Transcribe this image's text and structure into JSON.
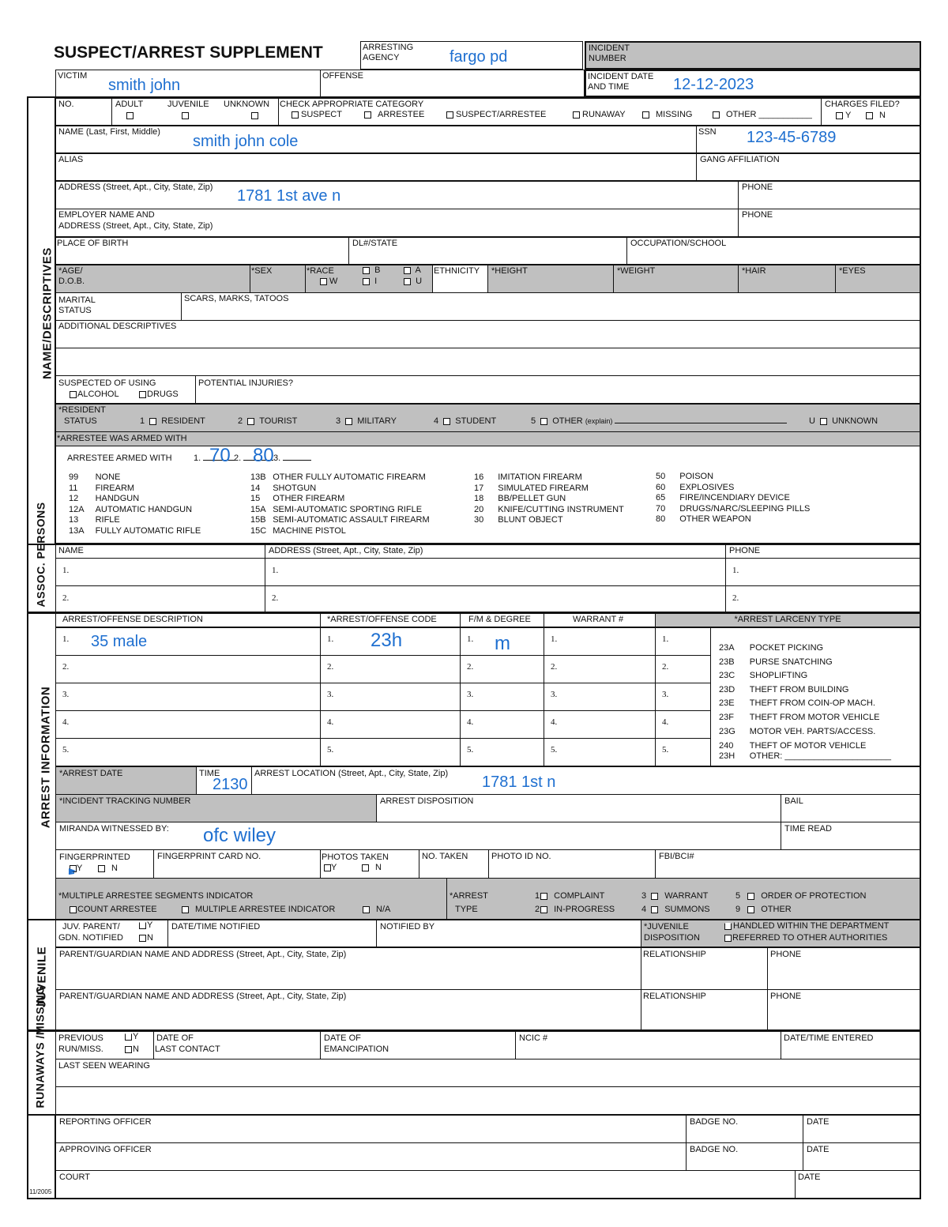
{
  "header": {
    "title": "SUSPECT/ARREST SUPPLEMENT",
    "arresting_agency_label": "ARRESTING AGENCY",
    "arresting_agency_value": "fargo pd",
    "incident_number_label": "INCIDENT NUMBER",
    "incident_number_value": "",
    "victim_label": "VICTIM",
    "victim_value": "smith john",
    "offense_label": "OFFENSE",
    "offense_value": "",
    "incident_date_label": "INCIDENT DATE AND TIME",
    "incident_date_value": "12-12-2023"
  },
  "sections": {
    "name_descriptives": "NAME/DESCRIPTIVES",
    "assoc_persons": "ASSOC. PERSONS",
    "arrest_information": "ARREST INFORMATION",
    "juvenile": "JUVENILE",
    "runaways_missing": "RUNAWAYS /MISSING",
    "form_version": "11/2005"
  },
  "name": {
    "no_label": "NO.",
    "adult_label": "ADULT",
    "juvenile_label": "JUVENILE",
    "unknown_label": "UNKNOWN",
    "category_label": "CHECK APPROPRIATE CATEGORY",
    "categories": [
      "SUSPECT",
      "ARRESTEE",
      "SUSPECT/ARRESTEE",
      "RUNAWAY",
      "MISSING",
      "OTHER ___________"
    ],
    "charges_filed_label": "CHARGES FILED?",
    "yes": "Y",
    "no": "N",
    "full_name_label": "NAME (Last, First, Middle)",
    "full_name_value": "smith john cole",
    "ssn_label": "SSN",
    "ssn_value": "123-45-6789",
    "alias_label": "ALIAS",
    "gang_label": "GANG AFFILIATION",
    "address_label": "ADDRESS (Street, Apt., City, State, Zip)",
    "address_value": "1781 1st ave n",
    "phone_label": "PHONE",
    "employer_label_1": "EMPLOYER NAME AND",
    "employer_label_2": "ADDRESS (Street, Apt., City, State, Zip)",
    "pob_label": "PLACE OF BIRTH",
    "dl_label": "DL#/STATE",
    "occupation_label": "OCCUPATION/SCHOOL",
    "age_label": "*AGE/",
    "dob_label": "D.O.B.",
    "sex_label": "*SEX",
    "race_label": "*RACE",
    "race_options": [
      "W",
      "B",
      "I",
      "A",
      "U"
    ],
    "ethnicity_label": "ETHNICITY",
    "height_label": "*HEIGHT",
    "weight_label": "*WEIGHT",
    "hair_label": "*HAIR",
    "eyes_label": "*EYES",
    "marital_label_1": "MARITAL",
    "marital_label_2": "STATUS",
    "scars_label": "SCARS, MARKS, TATOOS",
    "additional_label": "ADDITIONAL DESCRIPTIVES",
    "suspected_label": "SUSPECTED OF USING",
    "alcohol": "ALCOHOL",
    "drugs": "DRUGS",
    "injuries_label": "POTENTIAL INJURIES?",
    "resident_label_1": "*RESIDENT",
    "resident_label_2": "STATUS",
    "resident_options": [
      {
        "code": "1",
        "label": "RESIDENT"
      },
      {
        "code": "2",
        "label": "TOURIST"
      },
      {
        "code": "3",
        "label": "MILITARY"
      },
      {
        "code": "4",
        "label": "STUDENT"
      },
      {
        "code": "5",
        "label": "OTHER"
      },
      {
        "code": "U",
        "label": "UNKNOWN"
      }
    ],
    "explain": "(explain)",
    "armed_header": "*ARRESTEE WAS ARMED WITH",
    "armed_with_label": "ARRESTEE ARMED WITH",
    "armed_1": "70",
    "armed_2": "80",
    "armed_3": ""
  },
  "weapon_codes": [
    [
      {
        "c": "99",
        "l": "NONE"
      },
      {
        "c": "11",
        "l": "FIREARM"
      },
      {
        "c": "12",
        "l": "HANDGUN"
      },
      {
        "c": "12A",
        "l": "AUTOMATIC HANDGUN"
      },
      {
        "c": "13",
        "l": "RIFLE"
      },
      {
        "c": "13A",
        "l": "FULLY AUTOMATIC RIFLE"
      }
    ],
    [
      {
        "c": "13B",
        "l": "OTHER FULLY AUTOMATIC FIREARM"
      },
      {
        "c": "14",
        "l": "SHOTGUN"
      },
      {
        "c": "15",
        "l": "OTHER FIREARM"
      },
      {
        "c": "15A",
        "l": "SEMI-AUTOMATIC SPORTING RIFLE"
      },
      {
        "c": "15B",
        "l": "SEMI-AUTOMATIC ASSAULT FIREARM"
      },
      {
        "c": "15C",
        "l": "MACHINE PISTOL"
      }
    ],
    [
      {
        "c": "16",
        "l": "IMITATION FIREARM"
      },
      {
        "c": "17",
        "l": "SIMULATED FIREARM"
      },
      {
        "c": "18",
        "l": "BB/PELLET GUN"
      },
      {
        "c": "20",
        "l": "KNIFE/CUTTING INSTRUMENT"
      },
      {
        "c": "30",
        "l": "BLUNT OBJECT"
      }
    ],
    [
      {
        "c": "50",
        "l": "POISON"
      },
      {
        "c": "60",
        "l": "EXPLOSIVES"
      },
      {
        "c": "65",
        "l": "FIRE/INCENDIARY DEVICE"
      },
      {
        "c": "70",
        "l": "DRUGS/NARC/SLEEPING PILLS"
      },
      {
        "c": "80",
        "l": "OTHER WEAPON"
      }
    ]
  ],
  "assoc": {
    "name_label": "NAME",
    "address_label": "ADDRESS (Street, Apt., City, State, Zip)",
    "phone_label": "PHONE",
    "rows": [
      "1.",
      "2."
    ]
  },
  "arrest": {
    "desc_label": "ARREST/OFFENSE DESCRIPTION",
    "code_label": "*ARREST/OFFENSE CODE",
    "fm_label": "F/M & DEGREE",
    "warrant_label": "WARRANT #",
    "larceny_label": "*ARREST LARCENY TYPE",
    "row_nums": [
      "1.",
      "2.",
      "3.",
      "4.",
      "5."
    ],
    "row1_desc": "35 male",
    "row1_code": "23h",
    "row1_fm": "m",
    "larceny_codes": [
      {
        "c": "23A",
        "l": "POCKET PICKING"
      },
      {
        "c": "23B",
        "l": "PURSE SNATCHING"
      },
      {
        "c": "23C",
        "l": "SHOPLIFTING"
      },
      {
        "c": "23D",
        "l": "THEFT FROM BUILDING"
      },
      {
        "c": "23E",
        "l": "THEFT FROM COIN-OP MACH."
      },
      {
        "c": "23F",
        "l": "THEFT FROM MOTOR VEHICLE"
      },
      {
        "c": "23G",
        "l": "MOTOR VEH. PARTS/ACCESS."
      },
      {
        "c": "240",
        "l": "THEFT OF MOTOR VEHICLE"
      },
      {
        "c": "23H",
        "l": "OTHER: ______________________"
      }
    ],
    "arrest_date_label": "*ARREST DATE",
    "time_label": "TIME",
    "time_value": "2130",
    "location_label": "ARREST LOCATION (Street, Apt., City, State, Zip)",
    "location_value": "1781 1st n",
    "tracking_label": "*INCIDENT TRACKING NUMBER",
    "disposition_label": "ARREST DISPOSITION",
    "bail_label": "BAIL",
    "miranda_label": "MIRANDA WITNESSED BY:",
    "miranda_value": "ofc wiley",
    "time_read_label": "TIME READ",
    "fingerprinted_label": "FINGERPRINTED",
    "fingerprinted_value": "Y",
    "fp_card_label": "FINGERPRINT CARD NO.",
    "photos_label": "PHOTOS TAKEN",
    "no_taken_label": "NO. TAKEN",
    "photo_id_label": "PHOTO ID NO.",
    "fbi_label": "FBI/BCI#",
    "multiple_label": "*MULTIPLE ARRESTEE SEGMENTS INDICATOR",
    "multiple_options": [
      "COUNT ARRESTEE",
      "MULTIPLE ARRESTEE INDICATOR",
      "N/A"
    ],
    "arrest_type_label_1": "*ARREST",
    "arrest_type_label_2": "TYPE",
    "arrest_types": [
      {
        "c": "1",
        "l": "COMPLAINT"
      },
      {
        "c": "2",
        "l": "IN-PROGRESS"
      },
      {
        "c": "3",
        "l": "WARRANT"
      },
      {
        "c": "4",
        "l": "SUMMONS"
      },
      {
        "c": "5",
        "l": "ORDER OF PROTECTION"
      },
      {
        "c": "9",
        "l": "OTHER"
      }
    ]
  },
  "juvenile": {
    "parent_notified_1": "JUV. PARENT/",
    "parent_notified_2": "GDN. NOTIFIED",
    "datetime_notified_label": "DATE/TIME NOTIFIED",
    "notified_by_label": "NOTIFIED BY",
    "disposition_label_1": "*JUVENILE",
    "disposition_label_2": "DISPOSITION",
    "disposition_options": [
      "HANDLED WITHIN THE DEPARTMENT",
      "REFERRED TO OTHER AUTHORITIES"
    ],
    "guardian_label": "PARENT/GUARDIAN NAME AND ADDRESS (Street, Apt., City, State, Zip)",
    "relationship_label": "RELATIONSHIP",
    "phone_label": "PHONE"
  },
  "runaway": {
    "previous_1": "PREVIOUS",
    "previous_2": "RUN/MISS.",
    "last_contact_1": "DATE OF",
    "last_contact_2": "LAST CONTACT",
    "emancipation_1": "DATE OF",
    "emancipation_2": "EMANCIPATION",
    "ncic_label": "NCIC #",
    "entered_label": "DATE/TIME ENTERED",
    "last_seen_label": "LAST SEEN WEARING"
  },
  "footer": {
    "reporting_label": "REPORTING OFFICER",
    "approving_label": "APPROVING OFFICER",
    "court_label": "COURT",
    "badge_label": "BADGE NO.",
    "date_label": "DATE"
  },
  "colors": {
    "handwriting": "#1e6fd0",
    "shading": "#c0c0c0"
  }
}
